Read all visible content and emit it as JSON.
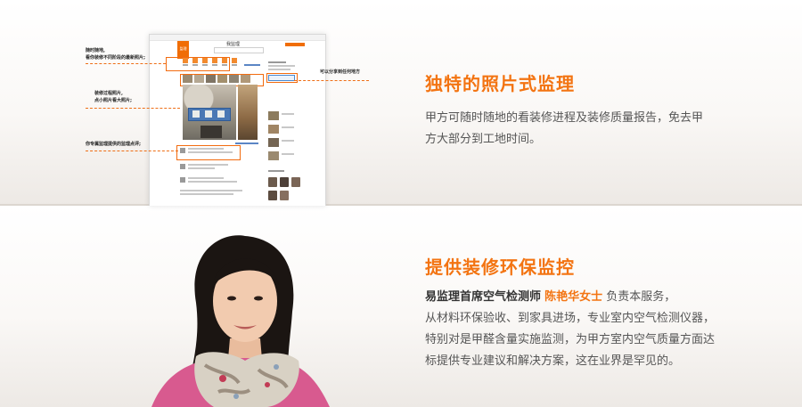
{
  "section1": {
    "heading": "独特的照片式监理",
    "body_lines": [
      "甲方可随时随地的看装修进程及装修质量报告，免去甲",
      "方大部分到工地时间。"
    ],
    "annotations": {
      "a1_line1": "随时随地,",
      "a1_line2": "看你装修不同阶段的最新照片;",
      "a2_line1": "装修过程照片,",
      "a2_line2": "点小照片看大照片;",
      "a3": "你专属监理提供的监理点评;",
      "a4": "可以分享到任何地方"
    },
    "mockup": {
      "site_title": "我监理",
      "logo_text": "监理"
    }
  },
  "section2": {
    "heading": "提供装修环保监控",
    "line1_strong": "易监理首席空气检测师",
    "line1_name": "陈艳华女士",
    "line1_rest": " 负责本服务，",
    "body_lines": [
      "从材料环保验收、到家具进场，专业室内空气检测仪器，",
      "特别对是甲醛含量实施监测，为甲方室内空气质量方面达",
      "标提供专业建议和解决方案，这在业界是罕见的。"
    ]
  },
  "colors": {
    "accent": "#f37412",
    "text": "#555555",
    "annotation_dash": "#ee6e16",
    "band_bottom": "#ede9e5"
  }
}
